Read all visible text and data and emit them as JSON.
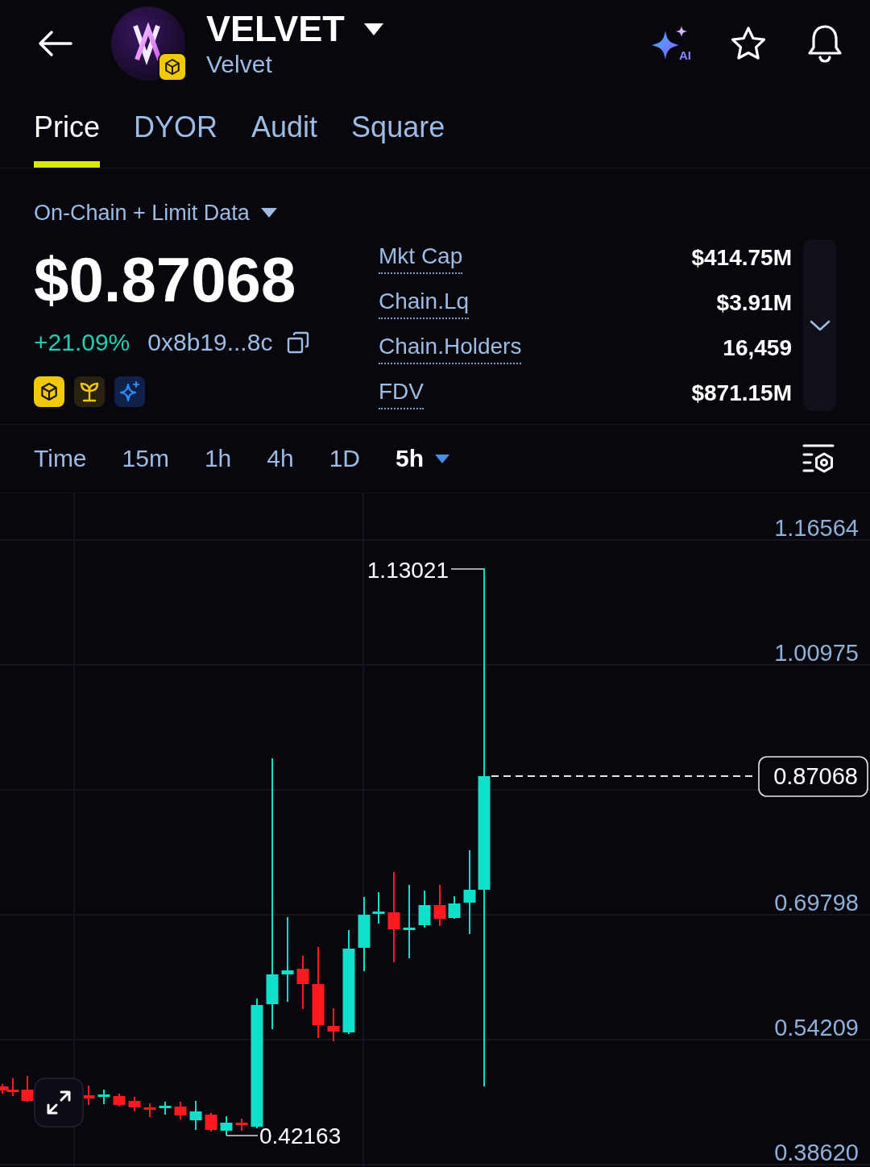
{
  "header": {
    "title": "VELVET",
    "subtitle": "Velvet",
    "ai_label": "AI"
  },
  "tabs": [
    {
      "label": "Price",
      "selected": true
    },
    {
      "label": "DYOR",
      "selected": false
    },
    {
      "label": "Audit",
      "selected": false
    },
    {
      "label": "Square",
      "selected": false
    }
  ],
  "data_source": {
    "label": "On-Chain + Limit Data"
  },
  "price": {
    "value": "$0.87068",
    "change": "+21.09%",
    "address": "0x8b19...8c"
  },
  "badges": [
    {
      "kind": "cube"
    },
    {
      "kind": "sprout"
    },
    {
      "kind": "sparkle"
    }
  ],
  "stats": [
    {
      "label": "Mkt Cap",
      "value": "$414.75M"
    },
    {
      "label": "Chain.Lq",
      "value": "$3.91M"
    },
    {
      "label": "Chain.Holders",
      "value": "16,459"
    },
    {
      "label": "FDV",
      "value": "$871.15M"
    }
  ],
  "stats_panel": {
    "expanded": false
  },
  "intervals": [
    {
      "label": "Time",
      "selected": false,
      "dropdown": false
    },
    {
      "label": "15m",
      "selected": false,
      "dropdown": false
    },
    {
      "label": "1h",
      "selected": false,
      "dropdown": false
    },
    {
      "label": "4h",
      "selected": false,
      "dropdown": false
    },
    {
      "label": "1D",
      "selected": false,
      "dropdown": false
    },
    {
      "label": "5h",
      "selected": true,
      "dropdown": true
    }
  ],
  "chart": {
    "axis_labels": [
      "1.16564",
      "1.00975",
      "0.69798",
      "0.54209",
      "0.38620"
    ],
    "high_label": "1.13021",
    "low_label": "0.42163",
    "last_price": "0.87068"
  }
}
